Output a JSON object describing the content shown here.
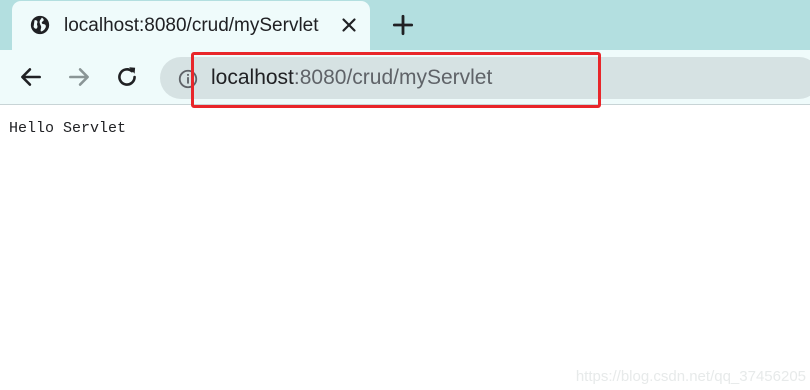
{
  "browser": {
    "tab": {
      "title": "localhost:8080/crud/myServlet",
      "icon": "globe-icon"
    },
    "new_tab_icon": "plus-icon",
    "nav": {
      "back_icon": "arrow-left-icon",
      "forward_icon": "arrow-right-icon",
      "reload_icon": "reload-icon"
    },
    "address_bar": {
      "host": "localhost",
      "rest": ":8080/crud/myServlet",
      "info_icon": "info-icon"
    },
    "annotation_color": "#e8262a"
  },
  "page": {
    "body_text": "Hello Servlet"
  },
  "watermark": "https://blog.csdn.net/qq_37456205"
}
